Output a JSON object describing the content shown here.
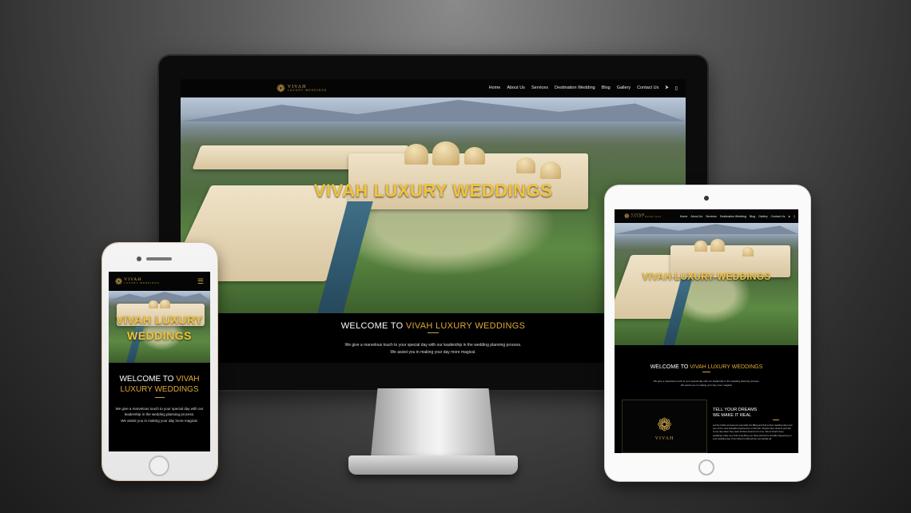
{
  "brand": {
    "title": "VIVAH",
    "subtitle": "LUXURY WEDDINGS",
    "accent": "#c9a24a",
    "headline": "#f2c23a"
  },
  "nav": {
    "items": [
      "Home",
      "About Us",
      "Services",
      "Destination Wedding",
      "Blog",
      "Gallery",
      "Contact Us"
    ],
    "share_icon": "share-icon",
    "phone_icon": "mobile-phone-icon",
    "menu_icon": "hamburger-menu-icon"
  },
  "hero": {
    "title": "VIVAH LUXURY WEDDINGS"
  },
  "welcome": {
    "prefix": "WELCOME TO",
    "highlight": "VIVAH LUXURY WEDDINGS",
    "line1": "We give a marvelous touch to your special day with our leadership in the wedding planning process.",
    "line2": "We assist you in making your day more magical."
  },
  "dreams": {
    "line1": "TELL YOUR DREAMS",
    "line2": "WE MAKE IT REAL",
    "body": "Let the brides and grooms just walk into Bling and that is their wedding day to be one of the most beautiful experiences in their life. People have dreams and this is one day when they want all their dreams turn true. We at Vivah luxury weddings make sure that everything you have planned is actually happening on your wedding day. From Mood to Mehndi we can handle all.",
    "card_logo": "VIVAH"
  }
}
